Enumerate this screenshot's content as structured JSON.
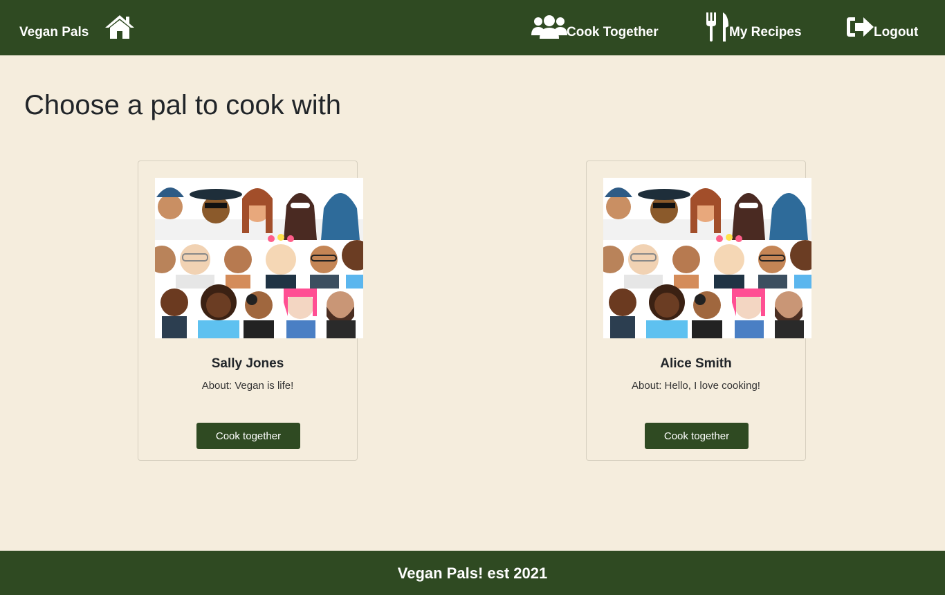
{
  "navbar": {
    "brand": "Vegan Pals",
    "home_icon": "home-icon",
    "links": [
      {
        "label": "Cook Together",
        "icon": "users-icon"
      },
      {
        "label": "My Recipes",
        "icon": "utensils-icon"
      },
      {
        "label": "Logout",
        "icon": "logout-icon"
      }
    ]
  },
  "main": {
    "title": "Choose a pal to cook with",
    "pals": [
      {
        "name": "Sally Jones",
        "about": "About: Vegan is life!",
        "button": "Cook together",
        "image": "diverse-people-avatars-illustration"
      },
      {
        "name": "Alice Smith",
        "about": "About: Hello, I love cooking!",
        "button": "Cook together",
        "image": "diverse-people-avatars-illustration"
      }
    ]
  },
  "footer": {
    "text": "Vegan Pals! est 2021"
  },
  "colors": {
    "primary": "#2f4a22",
    "background": "#f5eddd",
    "text": "#212529"
  }
}
